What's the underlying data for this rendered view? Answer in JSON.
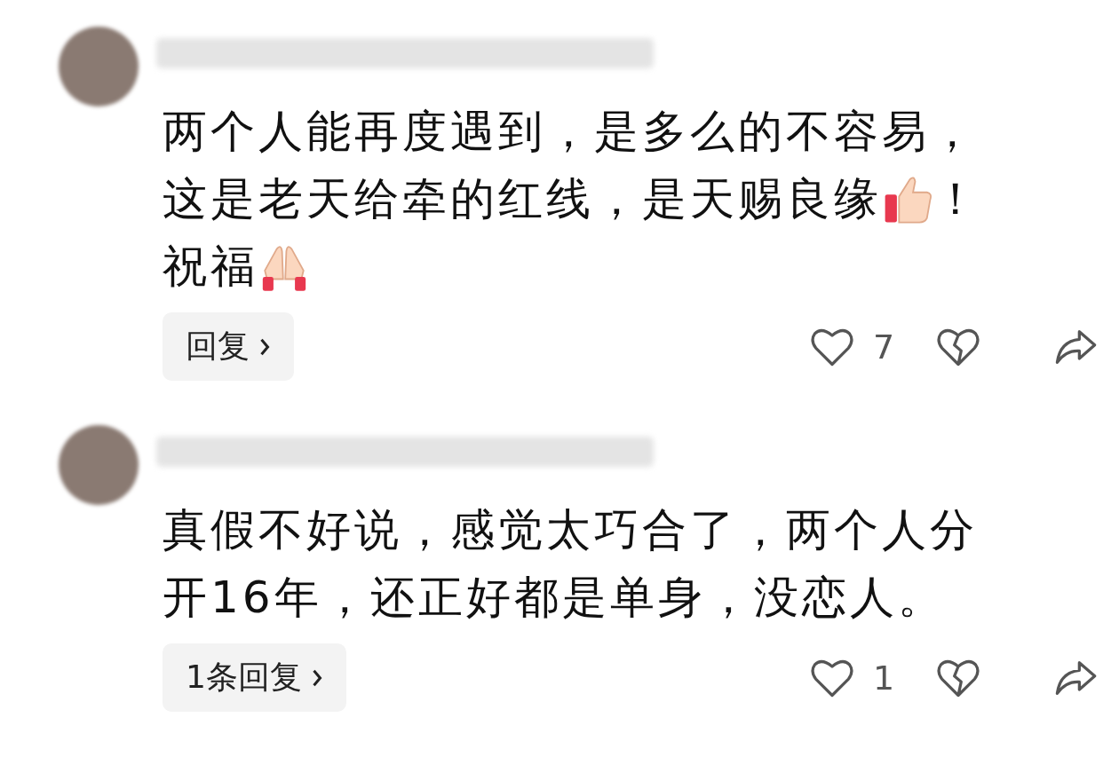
{
  "comments": [
    {
      "lines": [
        [
          {
            "kind": "text",
            "text": "两个人能再度遇到，是多么的不容易，"
          }
        ],
        [
          {
            "kind": "text",
            "text": "这是老天给牵的红线，是天赐良缘"
          },
          {
            "kind": "thumbs-up"
          },
          {
            "kind": "text",
            "text": "！"
          }
        ],
        [
          {
            "kind": "text",
            "text": "祝福"
          },
          {
            "kind": "praying-hands"
          }
        ]
      ],
      "reply_label": "回复",
      "likes": "7"
    },
    {
      "lines": [
        [
          {
            "kind": "text",
            "text": "真假不好说，感觉太巧合了，两个人分"
          }
        ],
        [
          {
            "kind": "text",
            "text": "开16年，还正好都是单身，没恋人。"
          }
        ]
      ],
      "reply_label": "1条回复",
      "likes": "1"
    }
  ]
}
